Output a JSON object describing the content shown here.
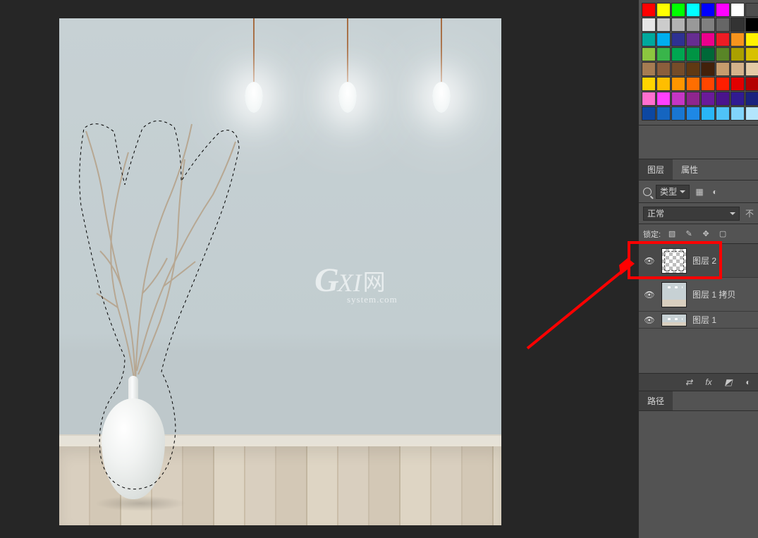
{
  "watermark": {
    "g": "G",
    "xi": "XI",
    "cn": "网",
    "sub": "system.com"
  },
  "swatch_colors": [
    "#ff0000",
    "#ffff00",
    "#00ff00",
    "#00ffff",
    "#0000ff",
    "#ff00ff",
    "#ffffff",
    "#4d4d4d",
    "#e6e6e6",
    "#cccccc",
    "#b3b3b3",
    "#999999",
    "#808080",
    "#666666",
    "#333333",
    "#000000",
    "#00a99d",
    "#00aeef",
    "#2e3192",
    "#662d91",
    "#ec008c",
    "#ed1c24",
    "#f7941d",
    "#fff200",
    "#8cc63f",
    "#39b54a",
    "#00a651",
    "#009444",
    "#006838",
    "#598527",
    "#aba000",
    "#d7c101",
    "#a67c52",
    "#8b5e3c",
    "#754c29",
    "#603913",
    "#42210b",
    "#c69c6d",
    "#d4b28b",
    "#e4cba6",
    "#ffd400",
    "#ffbe00",
    "#ff9600",
    "#ff6e00",
    "#ff4600",
    "#ff1e00",
    "#e20000",
    "#b40000",
    "#ff6fcf",
    "#ff40ff",
    "#c436c4",
    "#8e258e",
    "#6a1b9a",
    "#4a148c",
    "#311b92",
    "#1a237e",
    "#0d47a1",
    "#1565c0",
    "#1976d2",
    "#1e88e5",
    "#29b6f6",
    "#4fc3f7",
    "#81d4fa",
    "#b3e5fc"
  ],
  "tabs": {
    "layers": "图层",
    "properties": "属性"
  },
  "filter_type_label": "类型",
  "blend_mode": "正常",
  "lock_label": "锁定:",
  "layers": [
    {
      "name": "图层 2",
      "thumb": "transparent",
      "visible": true,
      "selected": true
    },
    {
      "name": "图层 1 拷贝",
      "thumb": "room",
      "visible": true,
      "selected": false
    },
    {
      "name": "图层 1",
      "thumb": "room",
      "visible": true,
      "selected": false
    }
  ],
  "fx_label": "fx",
  "paths_tab": "路径"
}
